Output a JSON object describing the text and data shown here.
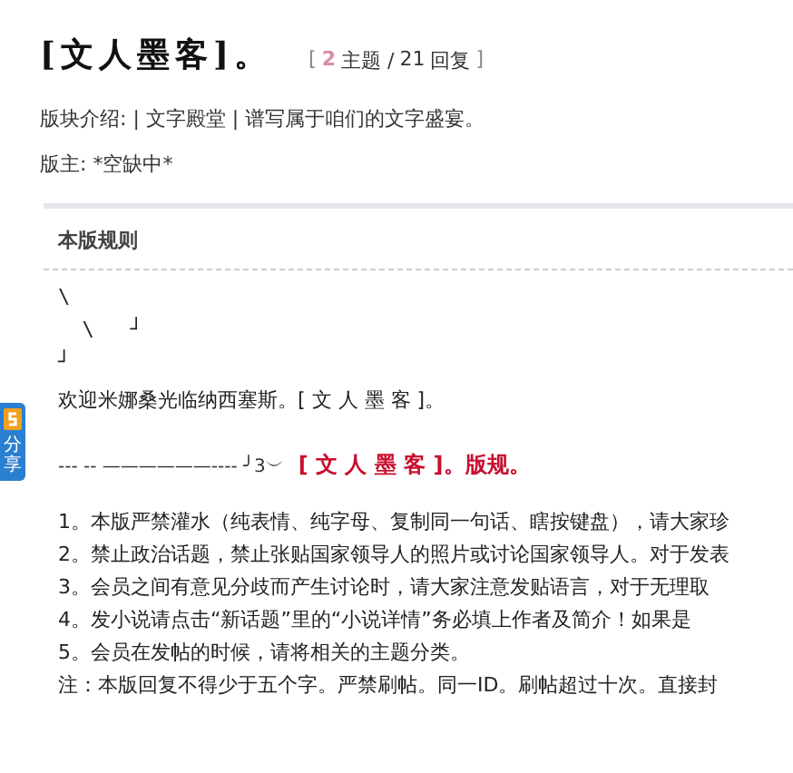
{
  "forum": {
    "title": "[文人墨客]。",
    "open_bracket": "[",
    "close_bracket": "]",
    "topics": "2",
    "topics_label": "主题 /",
    "replies": "21",
    "replies_label": "回复",
    "intro": "版块介绍: | 文字殿堂 | 谱写属于咱们的文字盛宴。",
    "moderator": "版主: *空缺中*"
  },
  "share_tab": {
    "label": "分享"
  },
  "rules": {
    "heading": "本版规则",
    "art": [
      "\\",
      "  \\   ┘",
      "┘"
    ],
    "welcome": "欢迎米娜桑光临纳西塞斯。[ 文 人 墨 客 ]。",
    "divider_text": "--- -- ——————---- ╯3︶",
    "banner": "[ 文 人 墨 客 ]。版规。",
    "items": [
      "1。本版严禁灌水（纯表情、纯字母、复制同一句话、瞎按键盘），请大家珍",
      "2。禁止政治话题，禁止张贴国家领导人的照片或讨论国家领导人。对于发表",
      "3。会员之间有意见分歧而产生讨论时，请大家注意发贴语言，对于无理取",
      "4。发小说请点击“新话题”里的“小说详情”务必填上作者及简介！如果是",
      "5。会员在发帖的时候，请将相关的主题分类。",
      "注：本版回复不得少于五个字。严禁刷帖。同一ID。刷帖超过十次。直接封"
    ]
  }
}
